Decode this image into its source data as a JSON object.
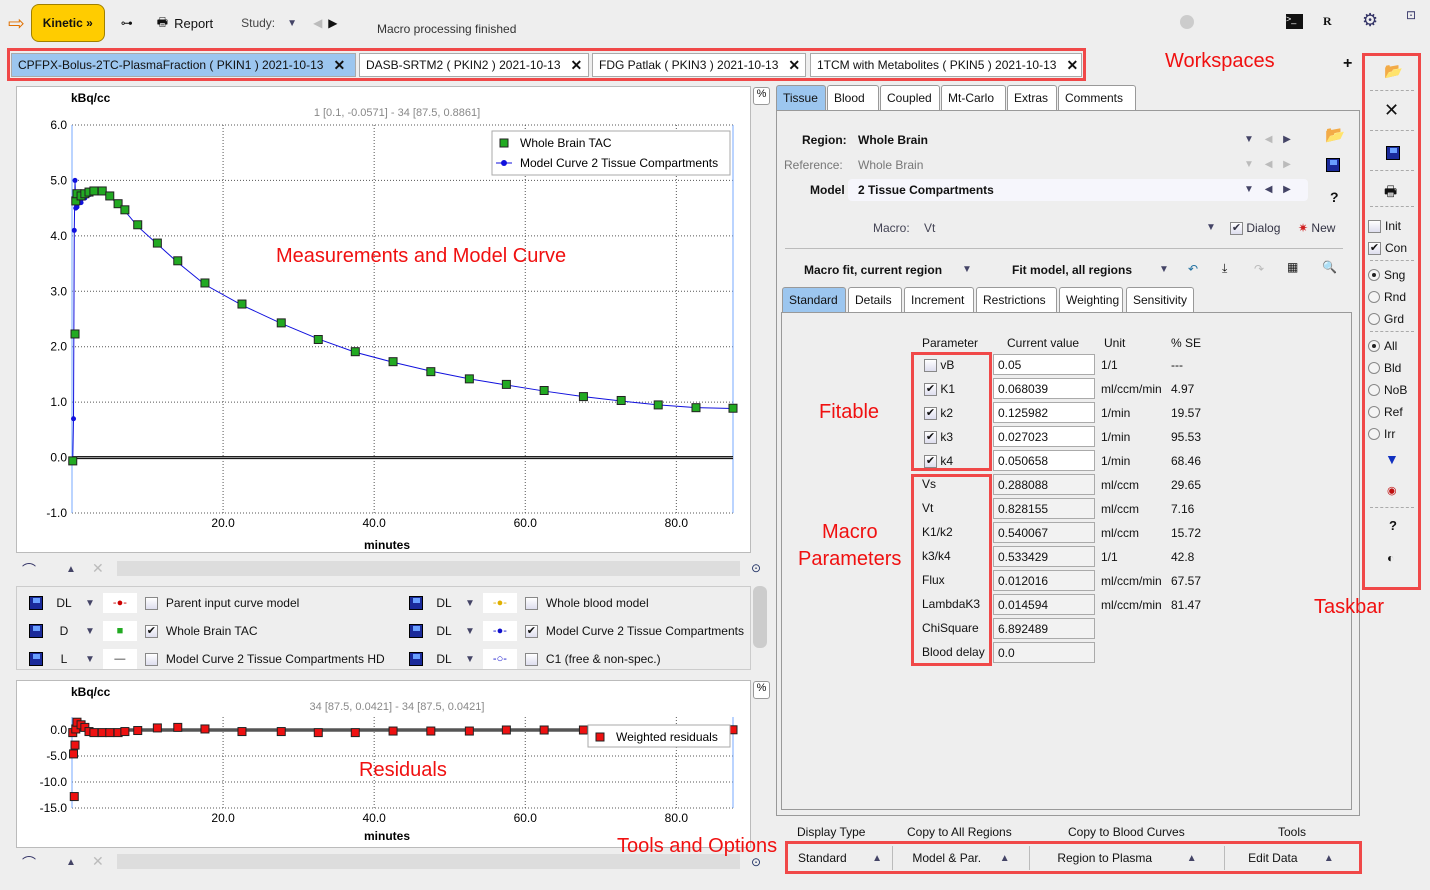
{
  "toolbar": {
    "kinetic": "Kinetic »",
    "report": "Report",
    "study": "Study:",
    "status": "Macro processing finished"
  },
  "workspaces": {
    "annotation": "Workspaces",
    "tabs": [
      {
        "label": "CPFPX-Bolus-2TC-PlasmaFraction ( PKIN1 ) 2021-10-13",
        "active": true
      },
      {
        "label": "DASB-SRTM2 ( PKIN2 ) 2021-10-13"
      },
      {
        "label": "FDG Patlak ( PKIN3 ) 2021-10-13"
      },
      {
        "label": "1TCM with Metabolites ( PKIN5 ) 2021-10-13"
      }
    ]
  },
  "annotations": {
    "measurements": "Measurements and Model Curve",
    "residuals": "Residuals",
    "fitable": "Fitable",
    "macro1": "Macro",
    "macro2": "Parameters",
    "taskbar": "Taskbar",
    "tools": "Tools and Options"
  },
  "chart_data": [
    {
      "type": "line",
      "ylabel": "kBq/cc",
      "xlabel": "minutes",
      "cursor": "1 [0.1, -0.0571] - 34 [87.5, 0.8861]",
      "xlim": [
        0,
        87.5
      ],
      "ylim": [
        -1,
        6
      ],
      "xticks": [
        "20.0",
        "40.0",
        "60.0",
        "80.0"
      ],
      "yticks": [
        "6.0",
        "5.0",
        "4.0",
        "3.0",
        "2.0",
        "1.0",
        "0.0",
        "-1.0"
      ],
      "grid": true,
      "legend": "top-right",
      "series": [
        {
          "name": "Whole Brain TAC",
          "color": "#22aa22",
          "marker": "square",
          "x": [
            0.1,
            0.4,
            0.5,
            0.66,
            1.2,
            1.7,
            2.25,
            2.9,
            4,
            5,
            6.1,
            7,
            8.7,
            11.3,
            14,
            17.6,
            22.5,
            27.7,
            32.6,
            37.5,
            42.5,
            47.5,
            52.6,
            57.5,
            62.5,
            67.7,
            72.7,
            77.6,
            82.6,
            87.5
          ],
          "y": [
            -0.06,
            2.23,
            4.63,
            4.76,
            4.72,
            4.76,
            4.79,
            4.81,
            4.81,
            4.72,
            4.58,
            4.47,
            4.2,
            3.87,
            3.55,
            3.15,
            2.77,
            2.43,
            2.13,
            1.91,
            1.73,
            1.55,
            1.42,
            1.32,
            1.21,
            1.1,
            1.03,
            0.95,
            0.9,
            0.89
          ]
        },
        {
          "name": "Model Curve 2 Tissue Compartments",
          "color": "#1010dd",
          "marker": "circle",
          "x": [
            0.1,
            0.2,
            0.3,
            0.4,
            0.5,
            0.66,
            1.2,
            1.7,
            2.25,
            2.9,
            4,
            5,
            6.1,
            7,
            8.7,
            11.3,
            14,
            17.6,
            22.5,
            27.7,
            32.6,
            37.5,
            42.5,
            47.5,
            52.6,
            57.5,
            62.5,
            67.7,
            72.7,
            77.6,
            82.6,
            87.5
          ],
          "y": [
            -0.0571,
            0.7,
            4.1,
            5.0,
            4.5,
            4.52,
            4.6,
            4.68,
            4.74,
            4.78,
            4.78,
            4.7,
            4.57,
            4.45,
            4.17,
            3.85,
            3.52,
            3.12,
            2.75,
            2.42,
            2.14,
            1.9,
            1.72,
            1.56,
            1.42,
            1.31,
            1.2,
            1.1,
            1.02,
            0.95,
            0.9,
            0.8861
          ]
        }
      ]
    },
    {
      "type": "scatter",
      "ylabel": "kBq/cc",
      "xlabel": "minutes",
      "cursor": "34 [87.5, 0.0421] - 34 [87.5, 0.0421]",
      "xlim": [
        0,
        87.5
      ],
      "ylim": [
        -15,
        2.5
      ],
      "xticks": [
        "20.0",
        "40.0",
        "60.0",
        "80.0"
      ],
      "yticks": [
        "0.0",
        "-5.0",
        "-10.0",
        "-15.0"
      ],
      "grid": true,
      "legend": "top-right",
      "series": [
        {
          "name": "Weighted residuals",
          "color": "#ee1111",
          "x": [
            0.1,
            0.2,
            0.3,
            0.4,
            0.5,
            0.66,
            1.2,
            1.7,
            2.25,
            2.9,
            4,
            5,
            6.1,
            7,
            8.7,
            11.3,
            14,
            17.6,
            22.5,
            27.7,
            32.6,
            37.5,
            42.5,
            47.5,
            52.6,
            57.5,
            62.5,
            67.7,
            72.7,
            77.6,
            82.6,
            87.5
          ],
          "y": [
            -0.5,
            -4.6,
            -12.8,
            -2.9,
            0.2,
            1.5,
            1.0,
            0.5,
            -0.3,
            -0.5,
            -0.5,
            -0.5,
            -0.5,
            -0.3,
            -0.1,
            0.4,
            0.5,
            0.2,
            -0.3,
            -0.3,
            -0.5,
            -0.5,
            -0.2,
            -0.2,
            -0.2,
            0.0,
            0.0,
            0.0,
            0.0,
            0.0,
            0.0,
            0.0421
          ]
        }
      ]
    }
  ],
  "legend_table": [
    {
      "mode": "DL",
      "label": "Parent input curve model",
      "checked": false,
      "sw": "-●-",
      "swc": "#cc0000"
    },
    {
      "mode": "D",
      "label": "Whole Brain TAC",
      "checked": true,
      "sw": "■",
      "swc": "#22aa22"
    },
    {
      "mode": "L",
      "label": "Model Curve 2 Tissue Compartments HD",
      "checked": false,
      "sw": "—",
      "swc": "#222"
    },
    {
      "mode": "DL",
      "label": "Whole blood model",
      "checked": false,
      "sw": "-●-",
      "swc": "#e0b000"
    },
    {
      "mode": "DL",
      "label": "Model Curve 2 Tissue Compartments",
      "checked": true,
      "sw": "-●-",
      "swc": "#1010cc"
    },
    {
      "mode": "DL",
      "label": "C1 (free & non-spec.)",
      "checked": false,
      "sw": "-○-",
      "swc": "#1010cc"
    }
  ],
  "right": {
    "tabs": [
      "Tissue",
      "Blood",
      "Coupled",
      "Mt-Carlo",
      "Extras",
      "Comments"
    ],
    "region_label": "Region:",
    "region": "Whole Brain",
    "reference_label": "Reference:",
    "reference": "Whole Brain",
    "model_label": "Model",
    "model": "2 Tissue Compartments",
    "macro_label": "Macro:",
    "macro": "Vt",
    "dialog": "Dialog",
    "new": "New",
    "fit1": "Macro fit, current region",
    "fit2": "Fit model, all regions",
    "subtabs": [
      "Standard",
      "Details",
      "Increment",
      "Restrictions",
      "Weighting",
      "Sensitivity"
    ],
    "headers": [
      "Parameter",
      "Current value",
      "Unit",
      "% SE"
    ],
    "fitable": [
      {
        "name": "vB",
        "checked": false,
        "value": "0.05",
        "unit": "1/1",
        "se": "---"
      },
      {
        "name": "K1",
        "checked": true,
        "value": "0.068039",
        "unit": "ml/ccm/min",
        "se": "4.97"
      },
      {
        "name": "k2",
        "checked": true,
        "value": "0.125982",
        "unit": "1/min",
        "se": "19.57"
      },
      {
        "name": "k3",
        "checked": true,
        "value": "0.027023",
        "unit": "1/min",
        "se": "95.53"
      },
      {
        "name": "k4",
        "checked": true,
        "value": "0.050658",
        "unit": "1/min",
        "se": "68.46"
      }
    ],
    "macro_params": [
      {
        "name": "Vs",
        "value": "0.288088",
        "unit": "ml/ccm",
        "se": "29.65"
      },
      {
        "name": "Vt",
        "value": "0.828155",
        "unit": "ml/ccm",
        "se": "7.16"
      },
      {
        "name": "K1/k2",
        "value": "0.540067",
        "unit": "ml/ccm",
        "se": "15.72"
      },
      {
        "name": "k3/k4",
        "value": "0.533429",
        "unit": "1/1",
        "se": "42.8"
      },
      {
        "name": "Flux",
        "value": "0.012016",
        "unit": "ml/ccm/min",
        "se": "67.57"
      },
      {
        "name": "LambdaK3",
        "value": "0.014594",
        "unit": "ml/ccm/min",
        "se": "81.47"
      },
      {
        "name": "ChiSquare",
        "value": "6.892489",
        "unit": "",
        "se": ""
      },
      {
        "name": "Blood delay",
        "value": "0.0",
        "unit": "",
        "se": ""
      }
    ]
  },
  "tools": {
    "headers": [
      "Display Type",
      "Copy to All Regions",
      "Copy to Blood Curves",
      "Tools"
    ],
    "buttons": [
      "Standard",
      "Model & Par.",
      "Region to Plasma",
      "Edit Data"
    ]
  },
  "taskbar": {
    "init": "Init",
    "con": "Con",
    "sng": "Sng",
    "rnd": "Rnd",
    "grd": "Grd",
    "all": "All",
    "bld": "Bld",
    "nob": "NoB",
    "ref": "Ref",
    "irr": "Irr"
  },
  "percent": "%",
  "help": "?"
}
